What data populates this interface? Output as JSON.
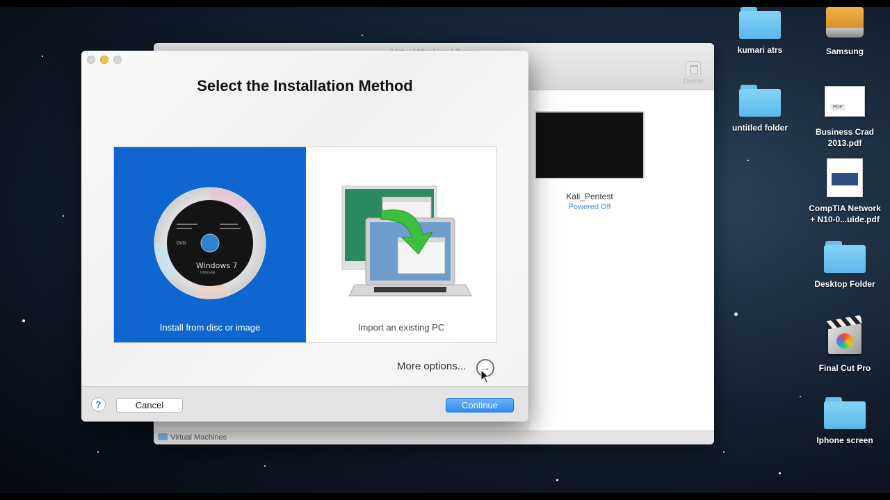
{
  "background_window": {
    "title": "Virtual Machine Library",
    "delete_label": "Delete",
    "vm": {
      "name": "Kali_Pentest",
      "status": "Powered Off"
    },
    "statusbar_label": "Virtual Machines"
  },
  "dialog": {
    "title": "Select the Installation Method",
    "options": [
      {
        "label": "Install from disc or image",
        "selected": true
      },
      {
        "label": "Import an existing PC",
        "selected": false
      }
    ],
    "disc_art": {
      "brand_text": "Windows 7",
      "edition_text": "Ultimate",
      "dvd_text": "DVD"
    },
    "more_options_label": "More options...",
    "more_options_arrow": "→",
    "help_label": "?",
    "cancel_label": "Cancel",
    "continue_label": "Continue"
  },
  "desktop_icons": [
    {
      "label": "kumari atrs",
      "icon": "folder-icon"
    },
    {
      "label": "Samsung",
      "icon": "drive-icon"
    },
    {
      "label": "untitled folder",
      "icon": "folder-icon"
    },
    {
      "label": "Business Crad 2013.pdf",
      "icon": "pdf-document-icon",
      "tag": "PDF"
    },
    {
      "label": "CompTIA Network + N10-0...uide.pdf",
      "icon": "pdf-document-icon"
    },
    {
      "label": "Desktop Folder",
      "icon": "folder-icon"
    },
    {
      "label": "Final Cut Pro",
      "icon": "final-cut-pro-icon"
    },
    {
      "label": "Iphone screen",
      "icon": "folder-icon"
    }
  ],
  "colors": {
    "selected_option": "#1066cf",
    "continue_button": "#2e86f0",
    "status_text": "#4a90d9",
    "folder": "#6ec6f2"
  }
}
